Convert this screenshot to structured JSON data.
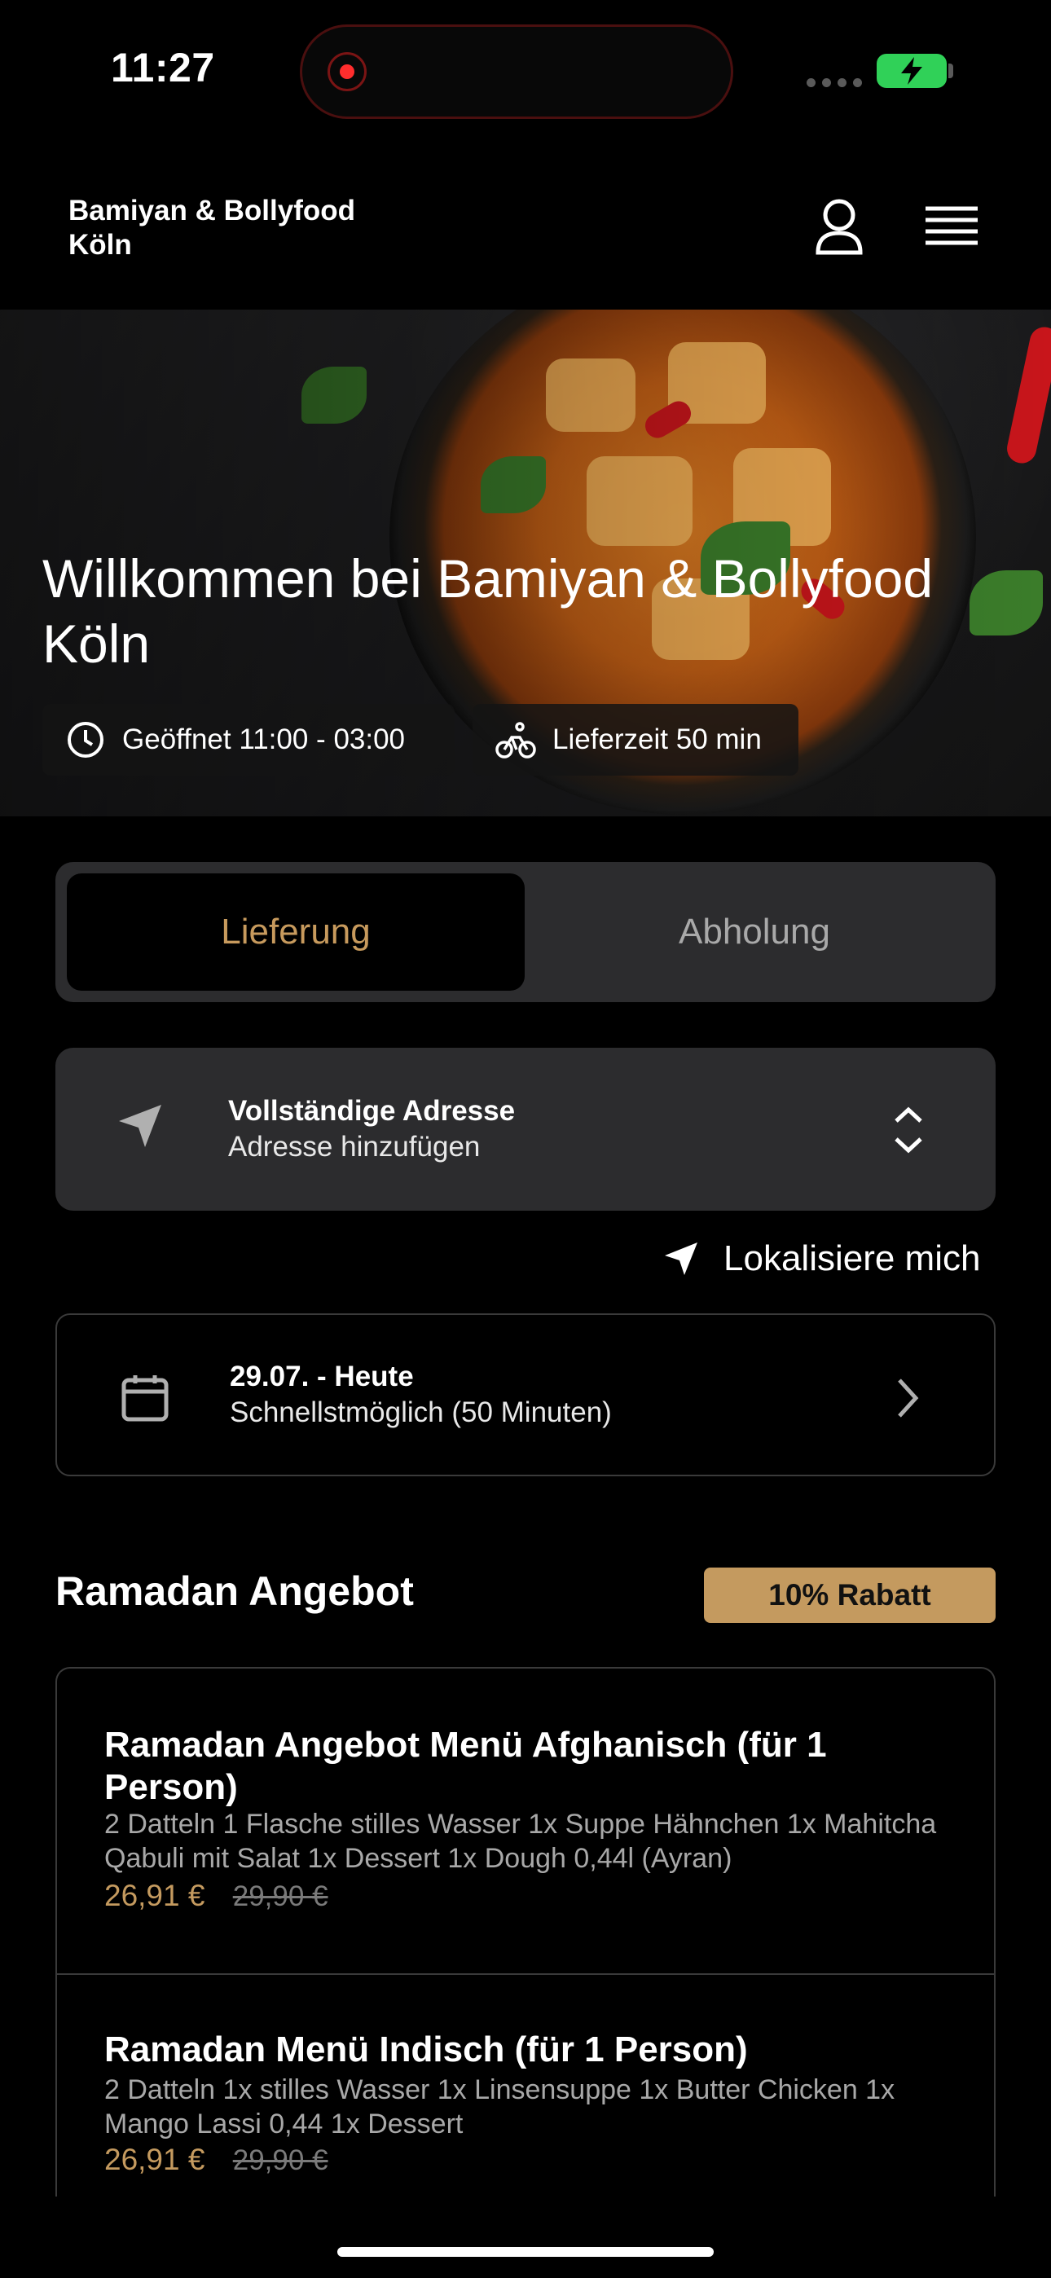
{
  "status_bar": {
    "time": "11:27"
  },
  "header": {
    "brand": "Bamiyan & Bollyfood Köln"
  },
  "hero": {
    "title": "Willkommen bei Bamiyan & Bollyfood Köln",
    "opening_hours": "Geöffnet 11:00 - 03:00",
    "delivery_time": "Lieferzeit 50 min"
  },
  "order_mode": {
    "delivery_label": "Lieferung",
    "pickup_label": "Abholung",
    "selected": "Lieferung"
  },
  "address": {
    "title": "Vollständige Adresse",
    "placeholder": "Adresse hinzufügen"
  },
  "locate_label": "Lokalisiere mich",
  "schedule": {
    "date": "29.07. - Heute",
    "time": "Schnellstmöglich (50 Minuten)"
  },
  "offers": {
    "section_title": "Ramadan Angebot",
    "badge": "10% Rabatt",
    "items": [
      {
        "name": "Ramadan Angebot Menü Afghanisch (für 1 Person)",
        "description": "2 Datteln 1 Flasche stilles Wasser 1x Suppe Hähnchen 1x Mahitcha Qabuli mit Salat 1x Dessert 1x Dough 0,44l (Ayran)",
        "price": "26,91 €",
        "old_price": "29,90 €"
      },
      {
        "name": "Ramadan Menü Indisch (für 1 Person)",
        "description": "2 Datteln 1x stilles Wasser 1x Linsensuppe 1x Butter Chicken 1x Mango Lassi 0,44 1x Dessert",
        "price": "26,91 €",
        "old_price": "29,90 €"
      }
    ]
  },
  "colors": {
    "accent": "#c49a5f",
    "card": "#2c2c2e",
    "background": "#000000"
  },
  "icons": [
    "user-icon",
    "menu-icon",
    "clock-icon",
    "bicycle-icon",
    "location-arrow-icon",
    "chevron-updown-icon",
    "calendar-icon",
    "chevron-right-icon"
  ]
}
